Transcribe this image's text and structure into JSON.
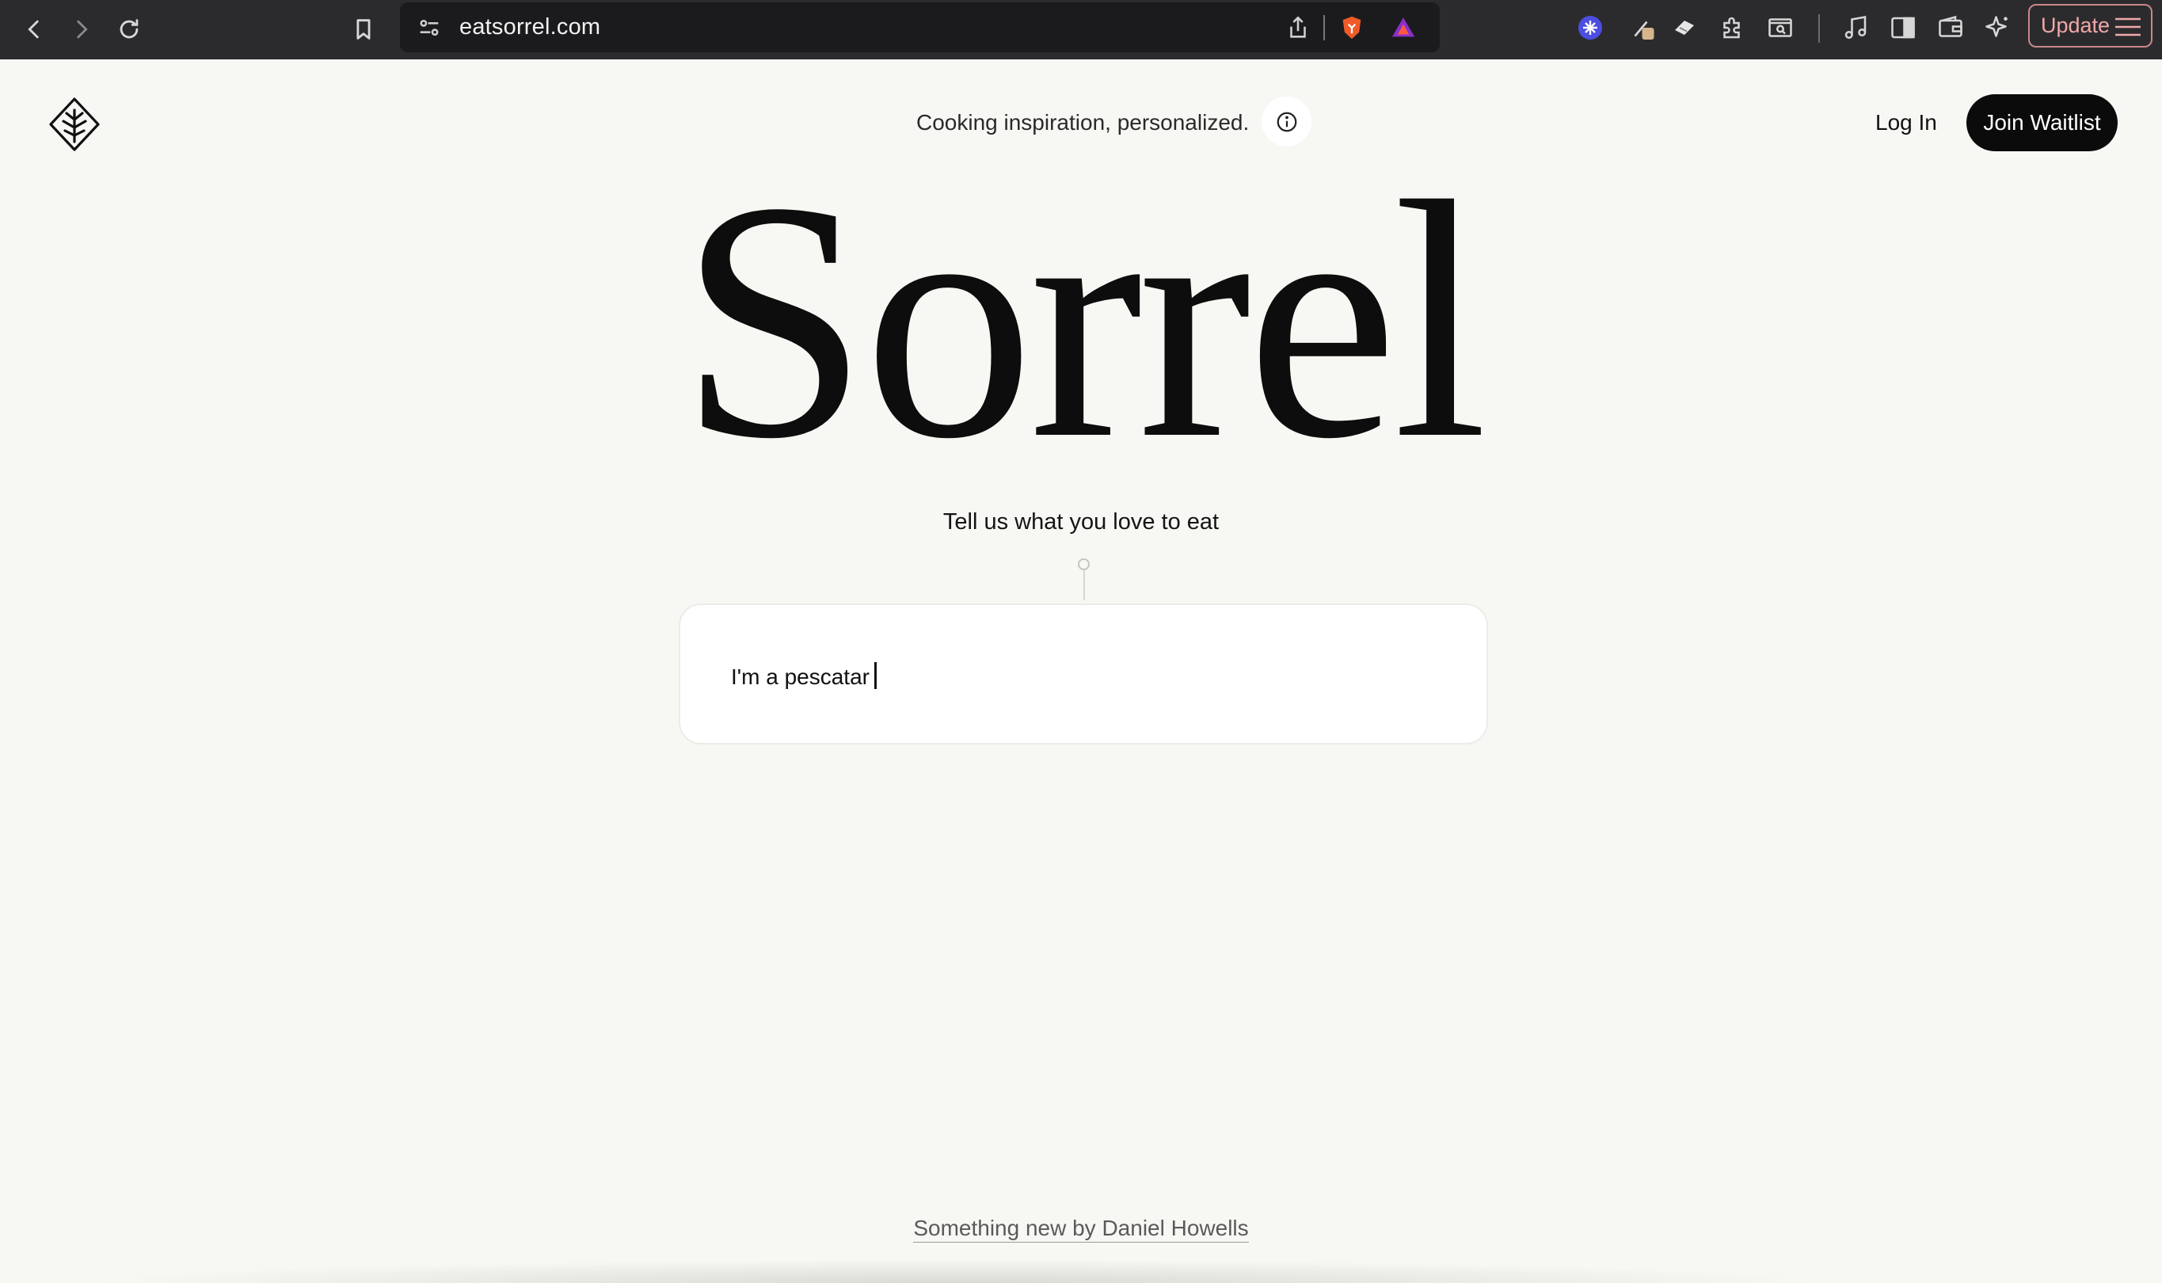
{
  "browser": {
    "url": "eatsorrel.com",
    "update_label": "Update",
    "icons": [
      "back-icon",
      "forward-icon",
      "reload-icon",
      "bookmark-icon",
      "site-settings-icon",
      "share-icon",
      "brave-shield-icon",
      "brave-rewards-icon",
      "extension-snowflake-icon",
      "extension-pen-icon",
      "extension-eraser-icon",
      "extensions-puzzle-icon",
      "screenshot-search-icon",
      "music-icon",
      "sidebar-icon",
      "wallet-icon",
      "leo-ai-icon",
      "menu-icon"
    ]
  },
  "header": {
    "tagline": "Cooking inspiration, personalized.",
    "login_label": "Log In",
    "join_label": "Join Waitlist"
  },
  "hero": {
    "title": "Sorrel",
    "subtitle": "Tell us what you love to eat"
  },
  "input": {
    "value": "I'm a pescatar"
  },
  "footer": {
    "link_text": "Something new by Daniel Howells"
  },
  "colors": {
    "page_bg": "#f7f7f3",
    "chrome_bg": "#2b2b2e",
    "button_bg": "#0b0b0b",
    "update_accent": "#f0a7a6"
  }
}
